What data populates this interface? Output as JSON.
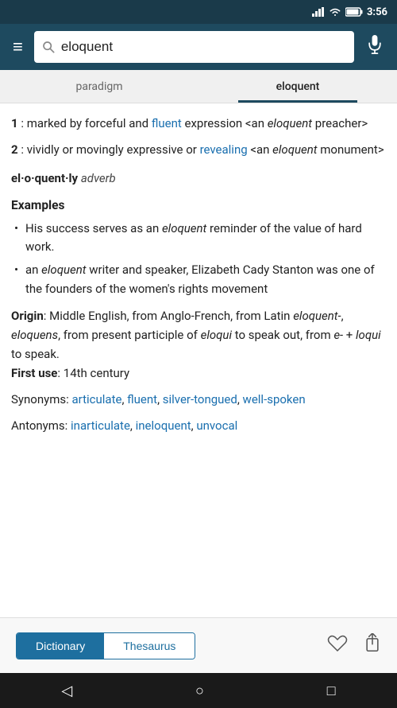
{
  "statusBar": {
    "time": "3:56",
    "icons": [
      "signal",
      "wifi",
      "battery"
    ]
  },
  "searchBar": {
    "menuLabel": "≡",
    "searchPlaceholder": "Search",
    "searchValue": "eloquent",
    "micLabel": "🎤"
  },
  "tabs": [
    {
      "id": "paradigm",
      "label": "paradigm",
      "active": false
    },
    {
      "id": "eloquent",
      "label": "eloquent",
      "active": true
    }
  ],
  "content": {
    "definitions": [
      {
        "num": "1",
        "colon": " : ",
        "text": "marked by ",
        "boldLink": "",
        "parts": [
          {
            "type": "text",
            "value": "marked by forceful and "
          },
          {
            "type": "link",
            "value": "fluent"
          },
          {
            "type": "text",
            "value": " expression <an "
          },
          {
            "type": "italic",
            "value": "eloquent"
          },
          {
            "type": "text",
            "value": " preacher>"
          }
        ]
      },
      {
        "num": "2",
        "parts": [
          {
            "type": "text",
            "value": "vividly or movingly expressive or "
          },
          {
            "type": "link",
            "value": "revealing"
          },
          {
            "type": "text",
            "value": " <an "
          },
          {
            "type": "italic",
            "value": "eloquent"
          },
          {
            "type": "text",
            "value": " monument>"
          }
        ]
      }
    ],
    "adverbLine": {
      "word": "el·o·quent·ly",
      "pos": "adverb"
    },
    "examplesTitle": "Examples",
    "examples": [
      {
        "parts": [
          {
            "type": "text",
            "value": "His success serves as an "
          },
          {
            "type": "italic",
            "value": "eloquent"
          },
          {
            "type": "text",
            "value": " reminder of the value of hard work."
          }
        ]
      },
      {
        "parts": [
          {
            "type": "text",
            "value": "an "
          },
          {
            "type": "italic",
            "value": "eloquent"
          },
          {
            "type": "text",
            "value": " writer and speaker, Elizabeth Cady Stanton was one of the founders of the women's rights movement"
          }
        ]
      }
    ],
    "origin": {
      "label": "Origin",
      "text": ": Middle English, from Anglo-French, from Latin ",
      "parts": [
        {
          "type": "text",
          "value": ": Middle English, from Anglo-French, from Latin "
        },
        {
          "type": "italic",
          "value": "eloquent-"
        },
        {
          "type": "text",
          "value": ", "
        },
        {
          "type": "italic",
          "value": "eloquens"
        },
        {
          "type": "text",
          "value": ", from present participle of "
        },
        {
          "type": "italic",
          "value": "eloqui"
        },
        {
          "type": "text",
          "value": " to speak out, from "
        },
        {
          "type": "italic",
          "value": "e-"
        },
        {
          "type": "text",
          "value": " + "
        },
        {
          "type": "italic",
          "value": "loqui"
        },
        {
          "type": "text",
          "value": " to speak."
        }
      ]
    },
    "firstUse": {
      "label": "First use",
      "value": ": 14th century"
    },
    "synonyms": {
      "label": "Synonyms",
      "links": [
        "articulate",
        "fluent",
        "silver-tongued",
        "well-spoken"
      ]
    },
    "antonyms": {
      "label": "Antonyms",
      "links": [
        "inarticulate",
        "ineloquent",
        "unvocal"
      ]
    }
  },
  "bottomTabs": {
    "dictionaryLabel": "Dictionary",
    "thesaurusLabel": "Thesaurus",
    "activeTab": "Dictionary",
    "heartLabel": "♡",
    "shareLabel": "⬆"
  },
  "androidNav": {
    "backLabel": "◁",
    "homeLabel": "○",
    "recentLabel": "□"
  }
}
